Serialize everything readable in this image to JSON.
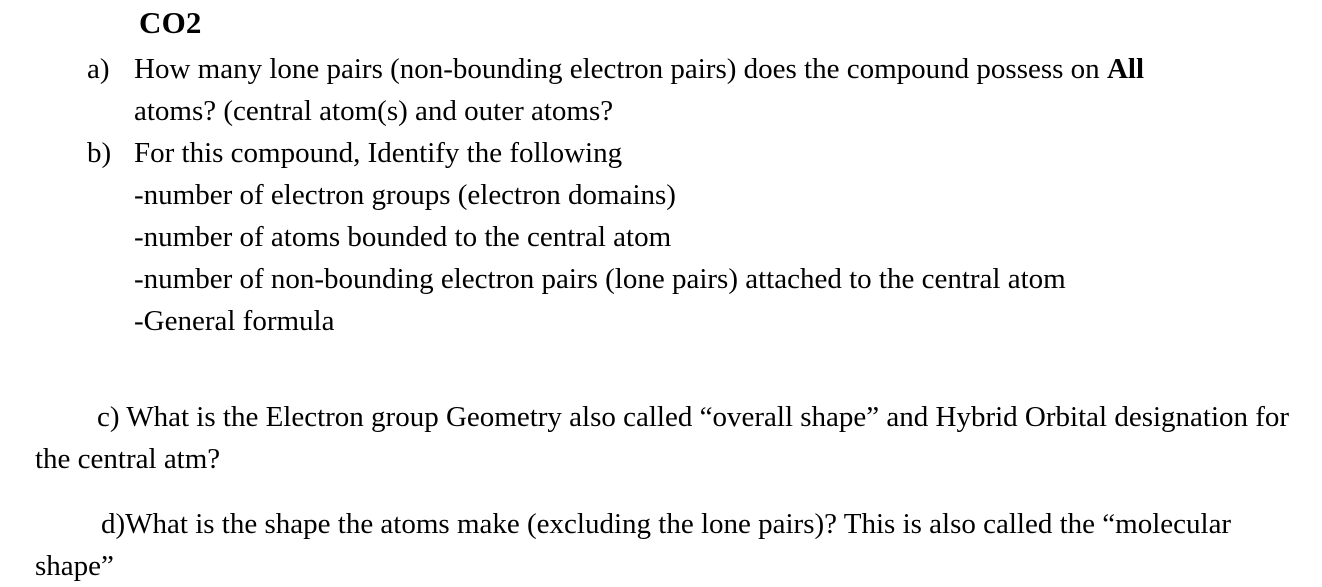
{
  "document": {
    "title": "CO2",
    "questions": [
      {
        "marker": "a)",
        "text_before_bold": "How many lone pairs (non-bounding electron pairs) does the compound possess on ",
        "bold_word": "All",
        "continuation": "atoms? (central atom(s) and outer atoms?",
        "sub_lines": []
      },
      {
        "marker": "b)",
        "text": "For this compound, Identify the following",
        "sub_lines": [
          "-number of electron groups (electron domains)",
          "-number of atoms bounded to the central atom",
          "-number of non-bounding electron pairs (lone pairs) attached to the central atom",
          "-General formula"
        ]
      }
    ],
    "paragraphs": [
      {
        "marker": "c)",
        "text": "c) What is the Electron group Geometry also called “overall shape” and Hybrid Orbital designation for the central atm?"
      },
      {
        "marker": "d)",
        "text": "d)What is the shape the atoms make (excluding the lone pairs)? This is also called the “molecular shape”"
      }
    ]
  },
  "colors": {
    "text": "#000000",
    "background": "#ffffff"
  }
}
